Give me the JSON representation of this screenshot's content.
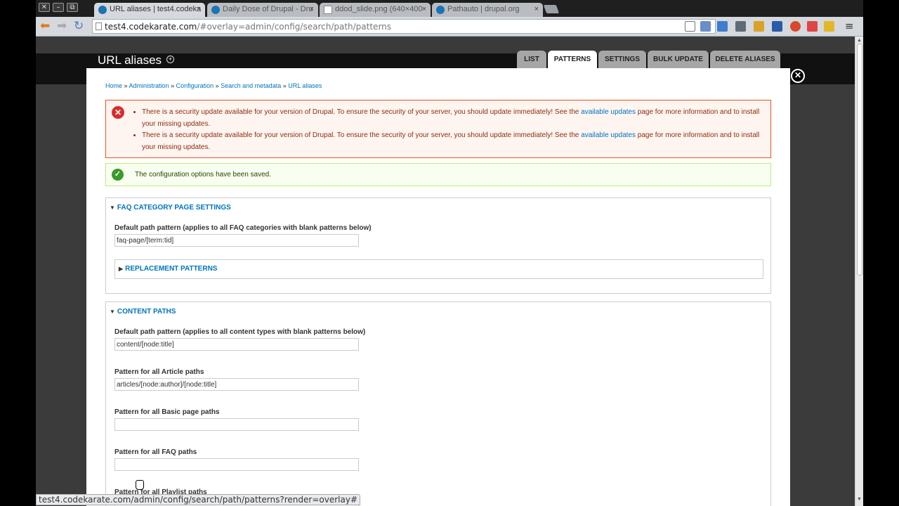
{
  "browser": {
    "window_buttons": [
      "✕",
      "–",
      "⧉"
    ],
    "tabs": [
      {
        "title": "URL aliases | test4.codeka",
        "close": "×",
        "icon": "drupal-icon"
      },
      {
        "title": "Daily Dose of Drupal - Dru",
        "close": "×",
        "icon": "drupal-icon"
      },
      {
        "title": "ddod_slide.png (640×400",
        "close": "×",
        "icon": "page-icon"
      },
      {
        "title": "Pathauto | drupal.org",
        "close": "×",
        "icon": "drupal-icon"
      }
    ],
    "url_host": "test4.codekarate.com",
    "url_path": "/#overlay=admin/config/search/path/patterns",
    "status_url": "test4.codekarate.com/admin/config/search/path/patterns?render=overlay#"
  },
  "page": {
    "title": "URL aliases",
    "tabs": [
      "LIST",
      "PATTERNS",
      "SETTINGS",
      "BULK UPDATE",
      "DELETE ALIASES"
    ],
    "active_tab": "PATTERNS",
    "breadcrumb": [
      "Home",
      "Administration",
      "Configuration",
      "Search and metadata",
      "URL aliases"
    ],
    "breadcrumb_sep": " » ",
    "messages": {
      "error_text_before": "There is a security update available for your version of Drupal. To ensure the security of your server, you should update immediately! See the ",
      "error_link": "available updates",
      "error_text_after": " page for more information and to install your missing updates.",
      "status": "The configuration options have been saved."
    },
    "faq": {
      "legend": "FAQ CATEGORY PAGE SETTINGS",
      "default_label": "Default path pattern (applies to all FAQ categories with blank patterns below)",
      "default_value": "faq-page/[term:tid]",
      "replacement": "REPLACEMENT PATTERNS"
    },
    "content": {
      "legend": "CONTENT PATHS",
      "default_label": "Default path pattern (applies to all content types with blank patterns below)",
      "default_value": "content/[node:title]",
      "article_label": "Pattern for all Article paths",
      "article_value": "articles/[node:author]/[node:title]",
      "basic_label": "Pattern for all Basic page paths",
      "basic_value": "",
      "faq_label": "Pattern for all FAQ paths",
      "faq_value": "",
      "playlist_label": "Pattern for all Playlist paths"
    }
  },
  "colors": {
    "link": "#0074bd",
    "error_border": "#ed541d",
    "status_border": "#bbee77"
  }
}
